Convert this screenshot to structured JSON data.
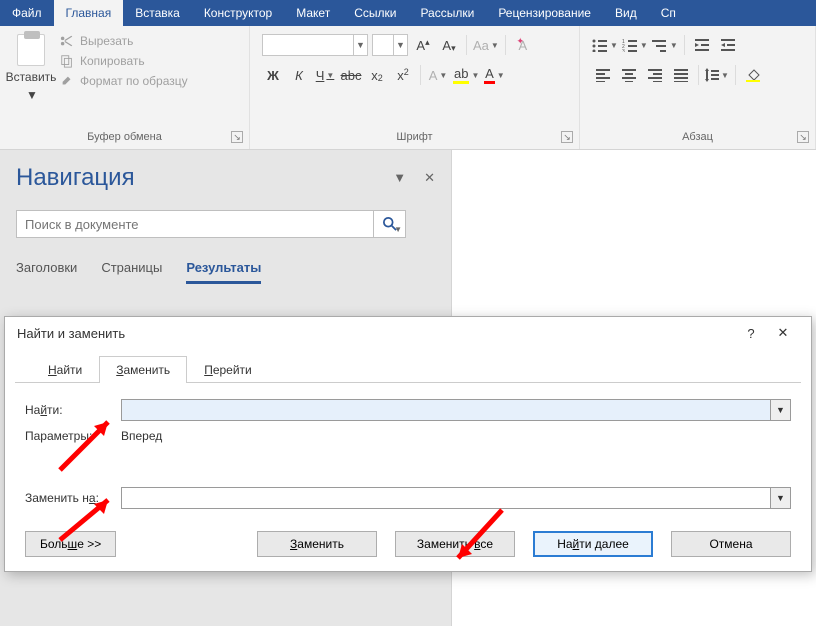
{
  "menu": {
    "items": [
      "Файл",
      "Главная",
      "Вставка",
      "Конструктор",
      "Макет",
      "Ссылки",
      "Рассылки",
      "Рецензирование",
      "Вид",
      "Сп"
    ],
    "active_index": 1
  },
  "ribbon": {
    "clipboard": {
      "label": "Буфер обмена",
      "paste": "Вставить",
      "cut": "Вырезать",
      "copy": "Копировать",
      "format_painter": "Формат по образцу"
    },
    "font": {
      "label": "Шрифт",
      "bold": "Ж",
      "italic": "К",
      "underline": "Ч",
      "strike": "abc",
      "subscript": "x",
      "superscript": "x"
    },
    "paragraph": {
      "label": "Абзац"
    }
  },
  "nav": {
    "title": "Навигация",
    "search_placeholder": "Поиск в документе",
    "tabs": [
      "Заголовки",
      "Страницы",
      "Результаты"
    ],
    "active_tab_index": 2
  },
  "dialog": {
    "title": "Найти и заменить",
    "tabs": {
      "find": "Найти",
      "replace": "Заменить",
      "goto": "Перейти"
    },
    "active_tab_index": 1,
    "find_label": "Найти:",
    "params_label": "Параметры:",
    "params_value": "Вперед",
    "replace_label": "Заменить на:",
    "find_value": "",
    "replace_value": "",
    "buttons": {
      "more": "Больше >>",
      "replace": "Заменить",
      "replace_all": "Заменить все",
      "find_next": "Найти далее",
      "cancel": "Отмена"
    },
    "help": "?",
    "close": "✕"
  }
}
